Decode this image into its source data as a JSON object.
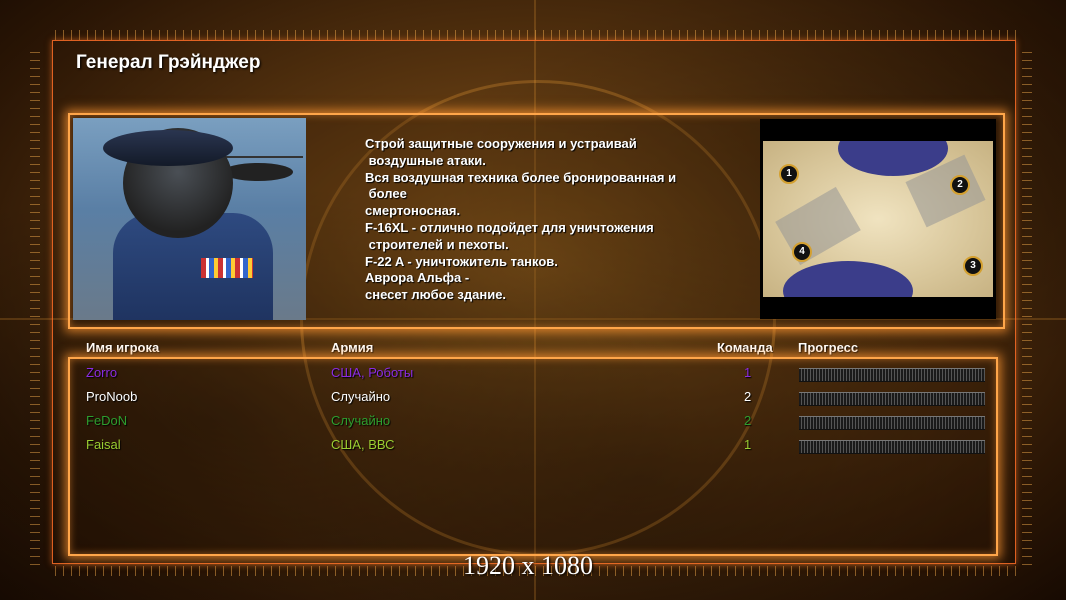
{
  "general_title": "Генерал Грэйнджер",
  "description_lines": [
    "Строй защитные сооружения и устраивай",
    " воздушные атаки.",
    "Вся воздушная техника более бронированная и",
    " более",
    "смертоносная.",
    "F-16XL - отлично подойдет для уничтожения",
    " строителей и пехоты.",
    "F-22 A - уничтожитель танков.",
    "Аврора Альфа -",
    "снесет любое здание."
  ],
  "minimap": {
    "start_positions": [
      "1",
      "2",
      "3",
      "4"
    ]
  },
  "table": {
    "headers": {
      "player": "Имя игрока",
      "army": "Армия",
      "team": "Команда",
      "progress": "Прогресс"
    },
    "rows": [
      {
        "player": "Zorro",
        "army": "США, Роботы",
        "team": "1",
        "color": "#8a2be2",
        "progress": 1.0
      },
      {
        "player": "ProNoob",
        "army": "Случайно",
        "team": "2",
        "color": "#ffffff",
        "progress": 1.0
      },
      {
        "player": "FeDoN",
        "army": "Случайно",
        "team": "2",
        "color": "#2e9e2e",
        "progress": 1.0
      },
      {
        "player": "Faisal",
        "army": "США, ВВС",
        "team": "1",
        "color": "#9acd32",
        "progress": 1.0
      }
    ]
  },
  "resolution_label": "1920 x 1080",
  "colors": {
    "accent_glow": "#ffa64a",
    "frame": "#ff6e28"
  }
}
